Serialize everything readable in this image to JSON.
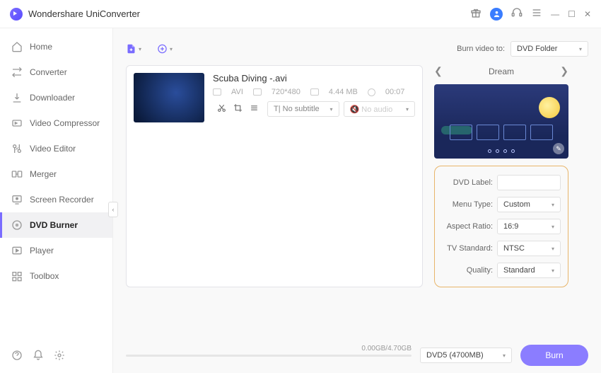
{
  "app": {
    "title": "Wondershare UniConverter"
  },
  "sidebar": {
    "items": [
      {
        "label": "Home",
        "icon": "home-icon"
      },
      {
        "label": "Converter",
        "icon": "converter-icon"
      },
      {
        "label": "Downloader",
        "icon": "downloader-icon"
      },
      {
        "label": "Video Compressor",
        "icon": "compressor-icon"
      },
      {
        "label": "Video Editor",
        "icon": "editor-icon"
      },
      {
        "label": "Merger",
        "icon": "merger-icon"
      },
      {
        "label": "Screen Recorder",
        "icon": "recorder-icon"
      },
      {
        "label": "DVD Burner",
        "icon": "dvd-icon"
      },
      {
        "label": "Player",
        "icon": "player-icon"
      },
      {
        "label": "Toolbox",
        "icon": "toolbox-icon"
      }
    ]
  },
  "burn_to": {
    "label": "Burn video to:",
    "value": "DVD Folder"
  },
  "file": {
    "name": "Scuba Diving -.avi",
    "format": "AVI",
    "resolution": "720*480",
    "size": "4.44 MB",
    "duration": "00:07",
    "subtitle": "No subtitle",
    "audio": "No audio"
  },
  "theme": {
    "name": "Dream"
  },
  "settings": {
    "dvd_label_label": "DVD Label:",
    "dvd_label_value": "",
    "menu_type_label": "Menu Type:",
    "menu_type_value": "Custom",
    "aspect_ratio_label": "Aspect Ratio:",
    "aspect_ratio_value": "16:9",
    "tv_standard_label": "TV Standard:",
    "tv_standard_value": "NTSC",
    "quality_label": "Quality:",
    "quality_value": "Standard"
  },
  "footer": {
    "progress": "0.00GB/4.70GB",
    "disc": "DVD5 (4700MB)",
    "burn": "Burn"
  },
  "subtitle_prefix": "T"
}
